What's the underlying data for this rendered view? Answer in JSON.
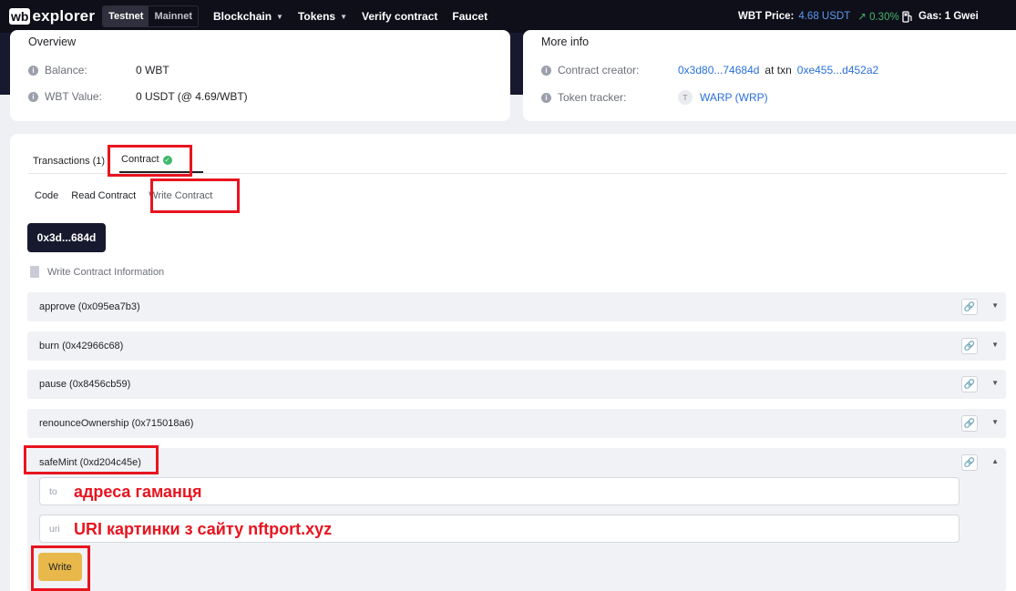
{
  "nav": {
    "logo_box": "wb",
    "logo_text": "explorer",
    "networks": [
      "Testnet",
      "Mainnet"
    ],
    "items": [
      {
        "label": "Blockchain",
        "dropdown": true
      },
      {
        "label": "Tokens",
        "dropdown": true
      },
      {
        "label": "Verify contract",
        "dropdown": false
      },
      {
        "label": "Faucet",
        "dropdown": false
      }
    ],
    "price_label": "WBT Price:",
    "price_value": "4.68 USDT",
    "price_change": "0.30%",
    "gas_label": "Gas: 1 Gwei"
  },
  "overview": {
    "title": "Overview",
    "balance_label": "Balance:",
    "balance_value": "0 WBT",
    "value_label": "WBT Value:",
    "value_value": "0 USDT (@ 4.69/WBT)"
  },
  "more_info": {
    "title": "More info",
    "creator_label": "Contract creator:",
    "creator_address": "0x3d80...74684d",
    "at_txn": "at txn",
    "txn_hash": "0xe455...d452a2",
    "tracker_label": "Token tracker:",
    "token_icon_letter": "T",
    "token_name": "WARP (WRP)"
  },
  "tabs": {
    "transactions": "Transactions (1)",
    "contract": "Contract"
  },
  "subtabs": [
    "Code",
    "Read Contract",
    "Write Contract"
  ],
  "contract_address": "0x3d...684d",
  "write_info": "Write Contract Information",
  "functions": [
    "approve (0x095ea7b3)",
    "burn (0x42966c68)",
    "pause (0x8456cb59)",
    "renounceOwnership (0x715018a6)",
    "safeMint (0xd204c45e)"
  ],
  "safemint": {
    "to_placeholder": "to",
    "to_note": "адреса гаманця",
    "uri_placeholder": "uri",
    "uri_note": "URI картинки з сайту nftport.xyz",
    "write_label": "Write"
  },
  "colors": {
    "nav_bg": "#0f0f1a",
    "link": "#2a6fdb",
    "highlight": "#e8141f",
    "write_button": "#e8b94a"
  }
}
